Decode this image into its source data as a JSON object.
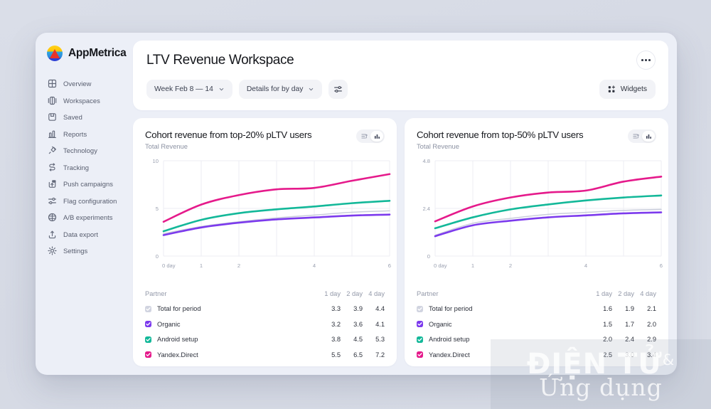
{
  "brand": {
    "name": "AppMetrica",
    "logo_icon": "appmetrica-logo"
  },
  "sidebar": {
    "items": [
      {
        "label": "Overview",
        "icon": "grid-icon"
      },
      {
        "label": "Workspaces",
        "icon": "layers-icon"
      },
      {
        "label": "Saved",
        "icon": "bookmark-icon"
      },
      {
        "label": "Reports",
        "icon": "bar-chart-icon"
      },
      {
        "label": "Technology",
        "icon": "plug-icon"
      },
      {
        "label": "Tracking",
        "icon": "tracking-icon"
      },
      {
        "label": "Push campaigns",
        "icon": "push-icon"
      },
      {
        "label": "Flag configuration",
        "icon": "sliders-icon"
      },
      {
        "label": "A/B experiments",
        "icon": "ab-test-icon"
      },
      {
        "label": "Data export",
        "icon": "upload-icon"
      },
      {
        "label": "Settings",
        "icon": "gear-icon"
      }
    ]
  },
  "header": {
    "title": "LTV Revenue Workspace",
    "period_selector": "Week Feb 8 — 14",
    "details_selector": "Details for by day",
    "filter_icon": "sliders-icon",
    "more_icon": "more-horizontal-icon",
    "widgets_label": "Widgets",
    "widgets_icon": "widgets-grid-icon"
  },
  "colors": {
    "total": "#c9cddb",
    "organic": "#7c3aed",
    "android": "#13b899",
    "yandex": "#e51a8b",
    "grid": "#eceef3",
    "axis_text": "#9aa0b0"
  },
  "cards": [
    {
      "title": "Cohort revenue from top-20% pLTV users",
      "subtitle": "Total Revenue",
      "toggle": {
        "list_icon": "list-view-icon",
        "chart_icon": "bar-chart-icon",
        "active": "chart"
      },
      "table": {
        "name_header": "Partner",
        "value_headers": [
          "1 day",
          "2 day",
          "4 day"
        ],
        "rows": [
          {
            "label": "Total for period",
            "color_key": "total",
            "checked": true,
            "values": [
              "3.3",
              "3.9",
              "4.4"
            ]
          },
          {
            "label": "Organic",
            "color_key": "organic",
            "checked": true,
            "values": [
              "3.2",
              "3.6",
              "4.1"
            ]
          },
          {
            "label": "Android setup",
            "color_key": "android",
            "checked": true,
            "values": [
              "3.8",
              "4.5",
              "5.3"
            ]
          },
          {
            "label": "Yandex.Direct",
            "color_key": "yandex",
            "checked": true,
            "values": [
              "5.5",
              "6.5",
              "7.2"
            ]
          }
        ]
      }
    },
    {
      "title": "Cohort revenue from top-50% pLTV users",
      "subtitle": "Total Revenue",
      "toggle": {
        "list_icon": "list-view-icon",
        "chart_icon": "bar-chart-icon",
        "active": "chart"
      },
      "table": {
        "name_header": "Partner",
        "value_headers": [
          "1 day",
          "2 day",
          "4 day"
        ],
        "rows": [
          {
            "label": "Total for period",
            "color_key": "total",
            "checked": true,
            "values": [
              "1.6",
              "1.9",
              "2.1"
            ]
          },
          {
            "label": "Organic",
            "color_key": "organic",
            "checked": true,
            "values": [
              "1.5",
              "1.7",
              "2.0"
            ]
          },
          {
            "label": "Android setup",
            "color_key": "android",
            "checked": true,
            "values": [
              "2.0",
              "2.4",
              "2.9"
            ]
          },
          {
            "label": "Yandex.Direct",
            "color_key": "yandex",
            "checked": true,
            "values": [
              "2.5",
              "3.0",
              "3.4"
            ]
          }
        ]
      }
    }
  ],
  "chart_data": [
    {
      "type": "line",
      "title": "Cohort revenue from top-20% pLTV users",
      "subtitle": "Total Revenue",
      "xlabel": "",
      "ylabel": "Total Revenue",
      "x": [
        0,
        1,
        2,
        3,
        4,
        5,
        6
      ],
      "xtick_labels": [
        "0 day",
        "1",
        "2",
        "",
        "4",
        "",
        "6"
      ],
      "ytick_labels": [
        "0",
        "5",
        "10"
      ],
      "yticks": [
        0,
        5,
        10
      ],
      "ylim": [
        0,
        10
      ],
      "xlim": [
        0,
        6
      ],
      "grid": "vertical",
      "legend_position": "table-below",
      "series": [
        {
          "name": "Yandex.Direct",
          "color": "#e51a8b",
          "values": [
            3.6,
            5.4,
            6.4,
            7.0,
            7.15,
            7.9,
            8.6
          ]
        },
        {
          "name": "Android setup",
          "color": "#13b899",
          "values": [
            2.6,
            3.8,
            4.5,
            4.9,
            5.2,
            5.55,
            5.8
          ]
        },
        {
          "name": "Total for period",
          "color": "#c9cddb",
          "values": [
            2.35,
            3.1,
            3.6,
            4.0,
            4.3,
            4.6,
            4.75
          ]
        },
        {
          "name": "Organic",
          "color": "#7c3aed",
          "values": [
            2.2,
            3.0,
            3.5,
            3.85,
            4.05,
            4.25,
            4.35
          ]
        }
      ]
    },
    {
      "type": "line",
      "title": "Cohort revenue from top-50% pLTV users",
      "subtitle": "Total Revenue",
      "xlabel": "",
      "ylabel": "Total Revenue",
      "x": [
        0,
        1,
        2,
        3,
        4,
        5,
        6
      ],
      "xtick_labels": [
        "0 day",
        "1",
        "2",
        "",
        "4",
        "",
        "6"
      ],
      "ytick_labels": [
        "0",
        "2.4",
        "4.8"
      ],
      "yticks": [
        0,
        2.4,
        4.8
      ],
      "ylim": [
        0,
        4.8
      ],
      "xlim": [
        0,
        6
      ],
      "grid": "vertical",
      "legend_position": "table-below",
      "series": [
        {
          "name": "Yandex.Direct",
          "color": "#e51a8b",
          "values": [
            1.75,
            2.5,
            2.95,
            3.2,
            3.3,
            3.75,
            4.0
          ]
        },
        {
          "name": "Android setup",
          "color": "#13b899",
          "values": [
            1.4,
            1.95,
            2.35,
            2.6,
            2.8,
            2.95,
            3.05
          ]
        },
        {
          "name": "Total for period",
          "color": "#c9cddb",
          "values": [
            1.05,
            1.65,
            1.9,
            2.1,
            2.2,
            2.3,
            2.35
          ]
        },
        {
          "name": "Organic",
          "color": "#7c3aed",
          "values": [
            1.0,
            1.55,
            1.78,
            1.95,
            2.05,
            2.15,
            2.2
          ]
        }
      ]
    }
  ],
  "watermark": {
    "line1": "ĐIỆN TỬ",
    "amp": "&",
    "line2": "Ứng dụng"
  }
}
